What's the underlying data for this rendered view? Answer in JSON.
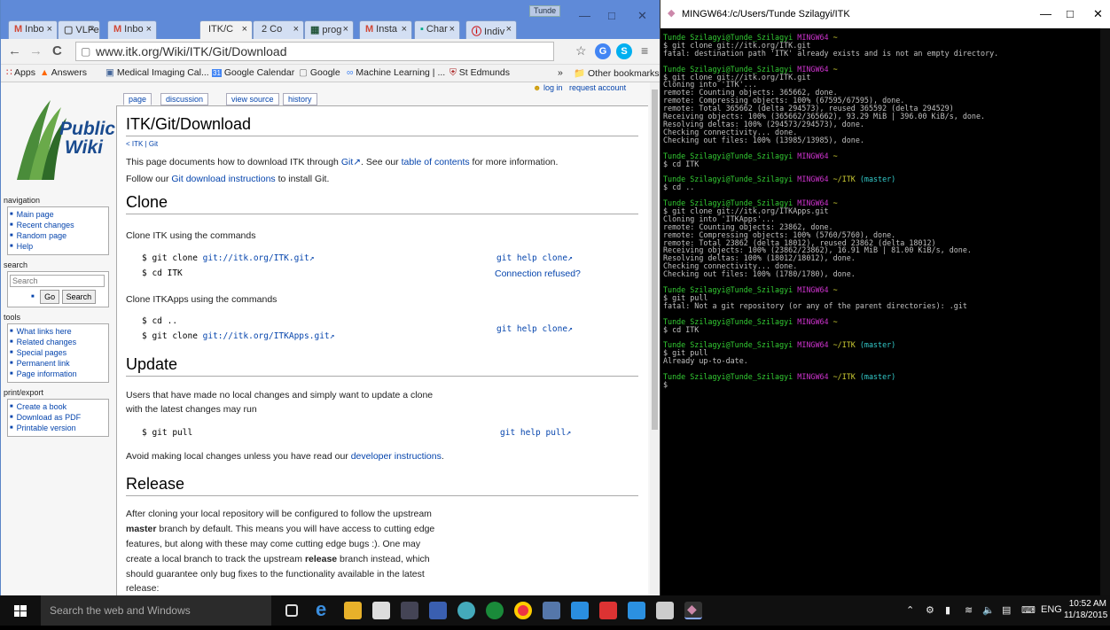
{
  "browser": {
    "tabs": [
      {
        "icon": "M",
        "label": "Inbo",
        "color": "#d14836"
      },
      {
        "icon": "▢",
        "label": "VLFe",
        "color": "#555"
      },
      {
        "icon": "M",
        "label": "Inbo",
        "color": "#d14836"
      },
      {
        "icon": "",
        "label": "ITK/C",
        "color": "#333"
      },
      {
        "icon": "",
        "label": "2 Co",
        "color": "#333"
      },
      {
        "icon": "▦",
        "label": "prog",
        "color": "#22553a"
      },
      {
        "icon": "M",
        "label": "Insta",
        "color": "#d14836"
      },
      {
        "icon": "▪",
        "label": "Char",
        "color": "#0a8"
      },
      {
        "icon": "ⓘ",
        "label": "Indiv",
        "color": "#c00"
      }
    ],
    "user_badge": "Tunde",
    "url": "www.itk.org/Wiki/ITK/Git/Download",
    "bookmarks": [
      "Apps",
      "Answers",
      "Medical Imaging Cal...",
      "Google Calendar",
      "Google",
      "Machine Learning | ...",
      "St Edmunds",
      "»",
      "Other bookmarks"
    ]
  },
  "wiki": {
    "logo_line1": "Public",
    "logo_line2": "Wiki",
    "nav_heading": "navigation",
    "nav_items": [
      "Main page",
      "Recent changes",
      "Random page",
      "Help"
    ],
    "search_heading": "search",
    "search_placeholder": "Search",
    "go_button": "Go",
    "search_button": "Search",
    "tools_heading": "tools",
    "tools_items": [
      "What links here",
      "Related changes",
      "Special pages",
      "Permanent link",
      "Page information"
    ],
    "print_heading": "print/export",
    "print_items": [
      "Create a book",
      "Download as PDF",
      "Printable version"
    ],
    "page_tabs": [
      "page",
      "discussion",
      "view source",
      "history"
    ],
    "login": "log in",
    "request_account": "request account",
    "title": "ITK/Git/Download",
    "breadcrumb": "< ITK | Git",
    "intro_1": "This page documents how to download ITK through ",
    "intro_git": "Git",
    "intro_2": ". See our ",
    "intro_toc": "table of contents",
    "intro_3": " for more information.",
    "follow_1": "Follow our ",
    "follow_link": "Git download instructions",
    "follow_2": " to install Git.",
    "clone_heading": "Clone",
    "clone_text": "Clone ITK using the commands",
    "cmd_clone_prefix": "$ git clone ",
    "cmd_clone_url": "git://itk.org/ITK.git",
    "cmd_cd_itk": "$ cd ITK",
    "help_clone": "git help clone",
    "connection_refused": "Connection refused?",
    "clone_apps_text": "Clone ITKApps using the commands",
    "cmd_cd_up": "$ cd ..",
    "cmd_clone_apps_url": "git://itk.org/ITKApps.git",
    "update_heading": "Update",
    "update_text_1": "Users that have made no local changes and simply want to update a clone",
    "update_text_2": "with the latest changes may run",
    "cmd_pull": "$ git pull",
    "help_pull": "git help pull",
    "avoid_1": "Avoid making local changes unless you have read our ",
    "avoid_link": "developer instructions",
    "avoid_2": ".",
    "release_heading": "Release",
    "release_1": "After cloning your local repository will be configured to follow the upstream",
    "release_2a": "master",
    "release_2b": " branch by default. This means you will have access to cutting edge",
    "release_3": "features, but along with these may come cutting edge bugs :). One may",
    "release_4a": "create a local branch to track the upstream ",
    "release_4b": "release",
    "release_4c": " branch instead, which",
    "release_5": "should guarantee only bug fixes to the functionality available in the latest",
    "release_6": "release:"
  },
  "terminal": {
    "title": "MINGW64:/c/Users/Tunde Szilagyi/ITK",
    "user": "Tunde Szilagyi@Tunde_Szilagyi",
    "env": "MINGW64",
    "lines": [
      {
        "type": "prompt",
        "dir": "~",
        "branch": ""
      },
      {
        "type": "out",
        "text": "$ git clone git://itk.org/ITK.git"
      },
      {
        "type": "out",
        "text": "fatal: destination path 'ITK' already exists and is not an empty directory."
      },
      {
        "type": "blank"
      },
      {
        "type": "prompt",
        "dir": "~",
        "branch": ""
      },
      {
        "type": "out",
        "text": "$ git clone git://itk.org/ITK.git"
      },
      {
        "type": "out",
        "text": "Cloning into 'ITK'..."
      },
      {
        "type": "out",
        "text": "remote: Counting objects: 365662, done."
      },
      {
        "type": "out",
        "text": "remote: Compressing objects: 100% (67595/67595), done."
      },
      {
        "type": "out",
        "text": "remote: Total 365662 (delta 294573), reused 365592 (delta 294529)"
      },
      {
        "type": "out",
        "text": "Receiving objects: 100% (365662/365662), 93.29 MiB | 396.00 KiB/s, done."
      },
      {
        "type": "out",
        "text": "Resolving deltas: 100% (294573/294573), done."
      },
      {
        "type": "out",
        "text": "Checking connectivity... done."
      },
      {
        "type": "out",
        "text": "Checking out files: 100% (13985/13985), done."
      },
      {
        "type": "blank"
      },
      {
        "type": "prompt",
        "dir": "~",
        "branch": ""
      },
      {
        "type": "out",
        "text": "$ cd ITK"
      },
      {
        "type": "blank"
      },
      {
        "type": "prompt",
        "dir": "~/ITK",
        "branch": "(master)"
      },
      {
        "type": "out",
        "text": "$ cd .."
      },
      {
        "type": "blank"
      },
      {
        "type": "prompt",
        "dir": "~",
        "branch": ""
      },
      {
        "type": "out",
        "text": "$ git clone git://itk.org/ITKApps.git"
      },
      {
        "type": "out",
        "text": "Cloning into 'ITKApps'..."
      },
      {
        "type": "out",
        "text": "remote: Counting objects: 23862, done."
      },
      {
        "type": "out",
        "text": "remote: Compressing objects: 100% (5760/5760), done."
      },
      {
        "type": "out",
        "text": "remote: Total 23862 (delta 18012), reused 23862 (delta 18012)"
      },
      {
        "type": "out",
        "text": "Receiving objects: 100% (23862/23862), 16.91 MiB | 81.00 KiB/s, done."
      },
      {
        "type": "out",
        "text": "Resolving deltas: 100% (18012/18012), done."
      },
      {
        "type": "out",
        "text": "Checking connectivity... done."
      },
      {
        "type": "out",
        "text": "Checking out files: 100% (1780/1780), done."
      },
      {
        "type": "blank"
      },
      {
        "type": "prompt",
        "dir": "~",
        "branch": ""
      },
      {
        "type": "out",
        "text": "$ git pull"
      },
      {
        "type": "out",
        "text": "fatal: Not a git repository (or any of the parent directories): .git"
      },
      {
        "type": "blank"
      },
      {
        "type": "prompt",
        "dir": "~",
        "branch": ""
      },
      {
        "type": "out",
        "text": "$ cd ITK"
      },
      {
        "type": "blank"
      },
      {
        "type": "prompt",
        "dir": "~/ITK",
        "branch": "(master)"
      },
      {
        "type": "out",
        "text": "$ git pull"
      },
      {
        "type": "out",
        "text": "Already up-to-date."
      },
      {
        "type": "blank"
      },
      {
        "type": "prompt",
        "dir": "~/ITK",
        "branch": "(master)"
      },
      {
        "type": "out",
        "text": "$"
      }
    ]
  },
  "taskbar": {
    "search_placeholder": "Search the web and Windows",
    "language": "ENG",
    "time": "10:52 AM",
    "date": "11/18/2015"
  },
  "colors": {
    "chrome_frame": "#5f8ad8",
    "link": "#0645ad",
    "terminal_green": "#33cc33",
    "terminal_magenta": "#cc33cc",
    "terminal_yellow": "#cccc33",
    "terminal_cyan": "#33cccc"
  }
}
